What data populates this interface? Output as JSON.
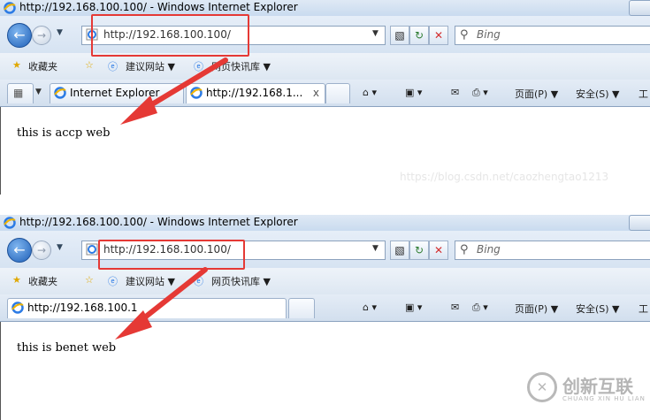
{
  "window1": {
    "title": "http://192.168.100.100/ - Windows Internet Explorer",
    "address": "http://192.168.100.100/",
    "search_placeholder": "Bing",
    "favorites_label": "收藏夹",
    "fav_suggested": "建议网站 ▼",
    "fav_slices": "网页快讯库 ▼",
    "tab1_label": "Internet Explorer",
    "tab2_label": "http://192.168.1...",
    "tab_close": "x",
    "cmd_page": "页面(P) ▼",
    "cmd_safety": "安全(S) ▼",
    "cmd_tools": "工",
    "page_text": "this is accp web"
  },
  "window2": {
    "title": "http://192.168.100.100/ - Windows Internet Explorer",
    "address": "http://192.168.100.100/",
    "search_placeholder": "Bing",
    "favorites_label": "收藏夹",
    "fav_suggested": "建议网站 ▼",
    "fav_slices": "网页快讯库 ▼",
    "tab1_label": "http://192.168.100.1",
    "cmd_page": "页面(P) ▼",
    "cmd_safety": "安全(S) ▼",
    "cmd_tools": "工",
    "page_text": "this is benet web"
  },
  "annotations": {
    "watermark": "https://blog.csdn.net/caozhengtao1213",
    "highlight_color": "#e53935",
    "logo_text": "创新互联",
    "logo_subtext": "CHUANG XIN HU LIAN"
  },
  "icons": [
    "ie-icon",
    "back-arrow-icon",
    "forward-arrow-icon",
    "refresh-icon",
    "stop-icon",
    "search-icon",
    "home-icon",
    "feeds-icon",
    "mail-icon",
    "print-icon",
    "favorites-star-icon",
    "red-arrow-icon"
  ]
}
